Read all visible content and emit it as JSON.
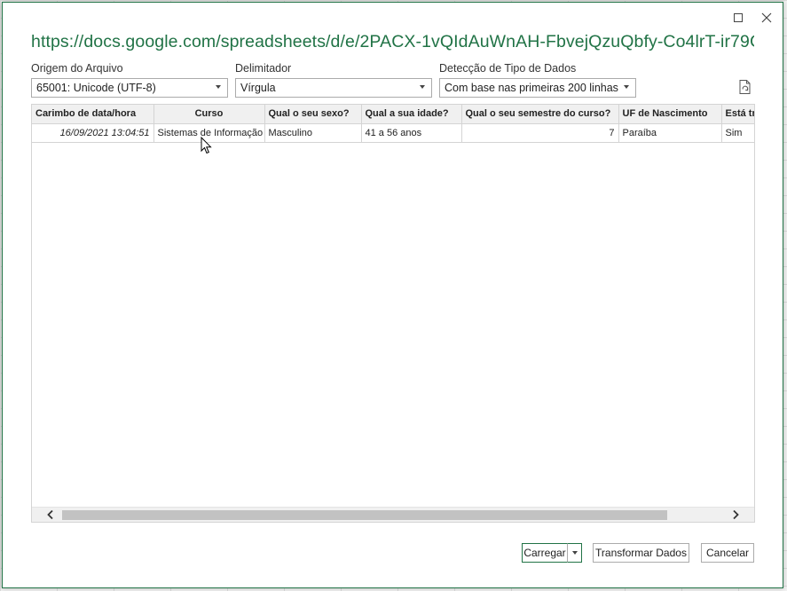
{
  "dialog": {
    "title": "https://docs.google.com/spreadsheets/d/e/2PACX-1vQIdAuWnAH-FbvejQzuQbfy-Co4lrT-ir79C..."
  },
  "fields": {
    "origin": {
      "label": "Origem do Arquivo",
      "value": "65001: Unicode (UTF-8)"
    },
    "delimiter": {
      "label": "Delimitador",
      "value": "Vírgula"
    },
    "detection": {
      "label": "Detecção de Tipo de Dados",
      "value": "Com base nas primeiras 200 linhas"
    }
  },
  "table": {
    "headers": [
      "Carimbo de data/hora",
      "Curso",
      "Qual o seu sexo?",
      "Qual a sua idade?",
      "Qual o seu semestre do curso?",
      "UF de Nascimento",
      "Está tra"
    ],
    "rows": [
      [
        "16/09/2021 13:04:51",
        "Sistemas de Informação",
        "Masculino",
        "41 a 56 anos",
        "7",
        "Paraíba",
        "Sim"
      ]
    ]
  },
  "buttons": {
    "load": "Carregar",
    "transform": "Transformar Dados",
    "cancel": "Cancelar"
  },
  "icons": {
    "close": "close-icon",
    "maximize": "maximize-icon",
    "refresh": "refresh-file-icon",
    "dropdown": "chevron-down-icon"
  },
  "colors": {
    "accent": "#217346"
  }
}
